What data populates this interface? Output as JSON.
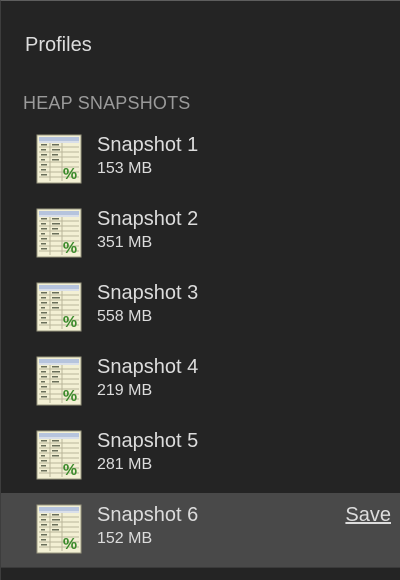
{
  "panel": {
    "title": "Profiles",
    "section_header": "HEAP SNAPSHOTS"
  },
  "snapshots": [
    {
      "name": "Snapshot 1",
      "size": "153 MB",
      "icon": "heap-snapshot-icon"
    },
    {
      "name": "Snapshot 2",
      "size": "351 MB",
      "icon": "heap-snapshot-icon"
    },
    {
      "name": "Snapshot 3",
      "size": "558 MB",
      "icon": "heap-snapshot-icon"
    },
    {
      "name": "Snapshot 4",
      "size": "219 MB",
      "icon": "heap-snapshot-icon"
    },
    {
      "name": "Snapshot 5",
      "size": "281 MB",
      "icon": "heap-snapshot-icon"
    },
    {
      "name": "Snapshot 6",
      "size": "152 MB",
      "icon": "heap-snapshot-icon",
      "selected": true,
      "action_label": "Save"
    }
  ],
  "colors": {
    "background": "#242424",
    "selected_row": "#494949",
    "text": "#dcdcdc",
    "section_header": "#9a9a9a",
    "icon_percent": "#3a8a2a"
  }
}
